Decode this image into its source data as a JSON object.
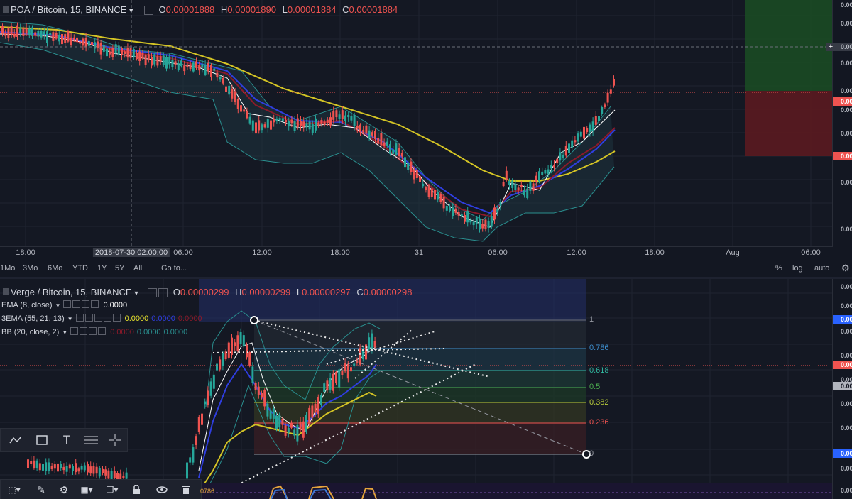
{
  "top_chart": {
    "symbol": "POA / Bitcoin, 15, BINANCE",
    "ohlc": {
      "o_label": "O",
      "o": "0.00001888",
      "h_label": "H",
      "h": "0.00001890",
      "l_label": "L",
      "l": "0.00001884",
      "c_label": "C",
      "c": "0.00001884"
    },
    "price_ticks": [
      "0.00",
      "0.00",
      "0.00",
      "0.00",
      "0.00",
      "0.00",
      "0.00",
      "0.00",
      "0.00",
      "0.00",
      "0.00"
    ],
    "time_labels": [
      "18:00",
      "2018-07-30 02:00:00",
      "06:00",
      "12:00",
      "18:00",
      "31",
      "06:00",
      "12:00",
      "18:00",
      "Aug",
      "06:00"
    ]
  },
  "range_bar": {
    "ranges": [
      "1Mo",
      "3Mo",
      "6Mo",
      "YTD",
      "1Y",
      "5Y",
      "All"
    ],
    "goto": "Go to...",
    "right": [
      "%",
      "log",
      "auto"
    ]
  },
  "bottom_chart": {
    "symbol": "Verge / Bitcoin, 15, BINANCE",
    "ohlc": {
      "o_label": "O",
      "o": "0.00000299",
      "h_label": "H",
      "h": "0.00000299",
      "l_label": "L",
      "l": "0.00000297",
      "c_label": "C",
      "c": "0.00000298"
    },
    "indicators": [
      {
        "name": "EMA (8, close)",
        "values": [
          "0.0000"
        ]
      },
      {
        "name": "3EMA (55, 21, 13)",
        "values": [
          "0.0000",
          "0.0000",
          "0.0000"
        ]
      },
      {
        "name": "BB (20, close, 2)",
        "values": [
          "0.0000",
          "0.0000",
          "0.0000"
        ]
      }
    ],
    "fib_levels": [
      "1",
      "0.786",
      "0.618",
      "0.5",
      "0.382",
      "0.236",
      "0"
    ],
    "price_ticks": [
      "0.000",
      "0.000",
      "0.000",
      "0.000",
      "0.000",
      "0.000",
      "0.000",
      "0.000",
      "0.000",
      "0.000",
      "0.000",
      "0.000",
      "0.000"
    ],
    "bottom_label": "0786"
  },
  "colors": {
    "up": "#26a69a",
    "down": "#ef5350",
    "ema_white": "#ffffff",
    "ema_yellow": "#d4c425",
    "ema_blue": "#2f3ee0",
    "bb": "#2a8f8f"
  }
}
